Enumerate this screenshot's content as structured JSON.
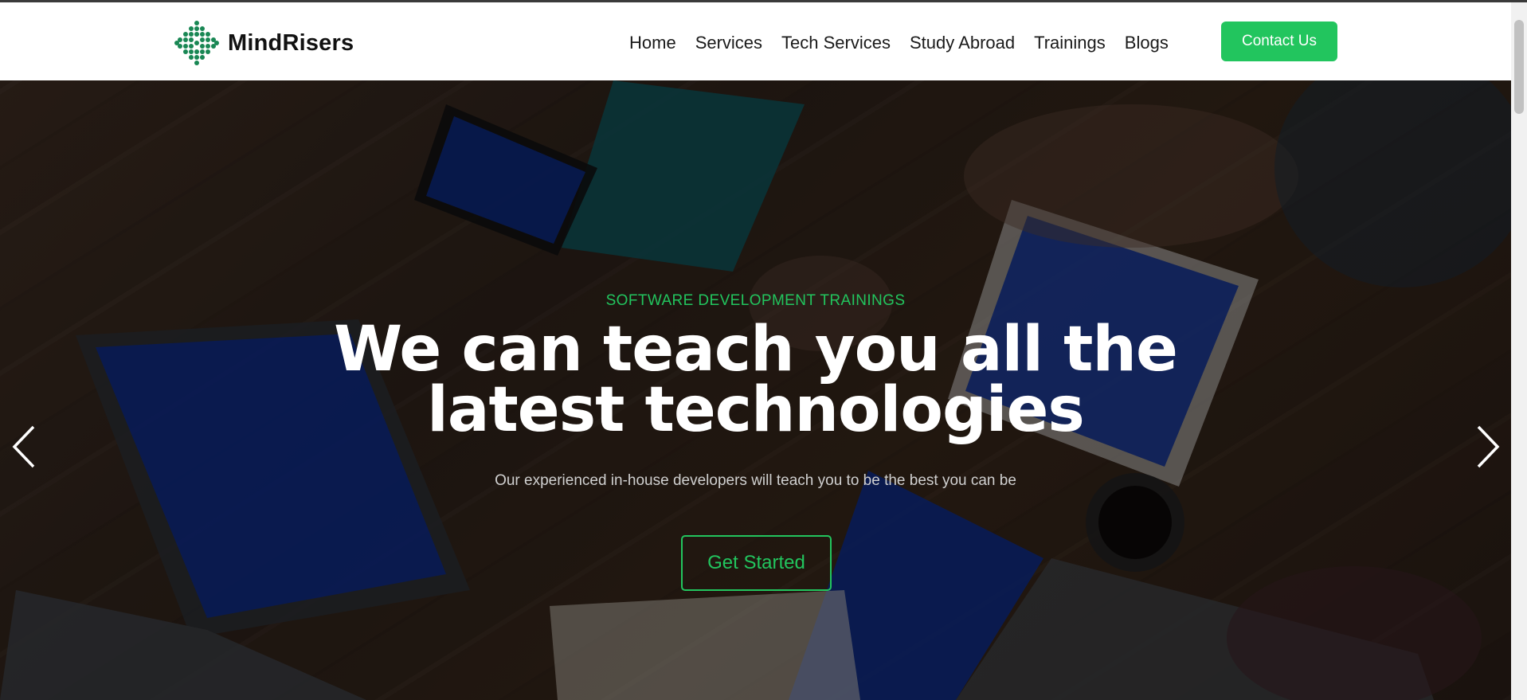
{
  "brand": {
    "name": "MindRisers",
    "logo_icon": "dots-diamond-icon",
    "color": "#198754"
  },
  "nav": {
    "items": [
      {
        "label": "Home"
      },
      {
        "label": "Services"
      },
      {
        "label": "Tech Services"
      },
      {
        "label": "Study Abroad"
      },
      {
        "label": "Trainings"
      },
      {
        "label": "Blogs"
      }
    ],
    "contact_label": "Contact Us"
  },
  "hero": {
    "eyebrow": "SOFTWARE DEVELOPMENT TRAININGS",
    "headline_line1": "We can teach you all the",
    "headline_line2": "latest technologies",
    "subline": "Our experienced in-house developers will teach you to be the best you can be",
    "cta_label": "Get Started",
    "prev_icon": "chevron-left-icon",
    "next_icon": "chevron-right-icon"
  },
  "colors": {
    "accent": "#22c55e",
    "text_dark": "#111111",
    "hero_overlay": "#000000"
  }
}
